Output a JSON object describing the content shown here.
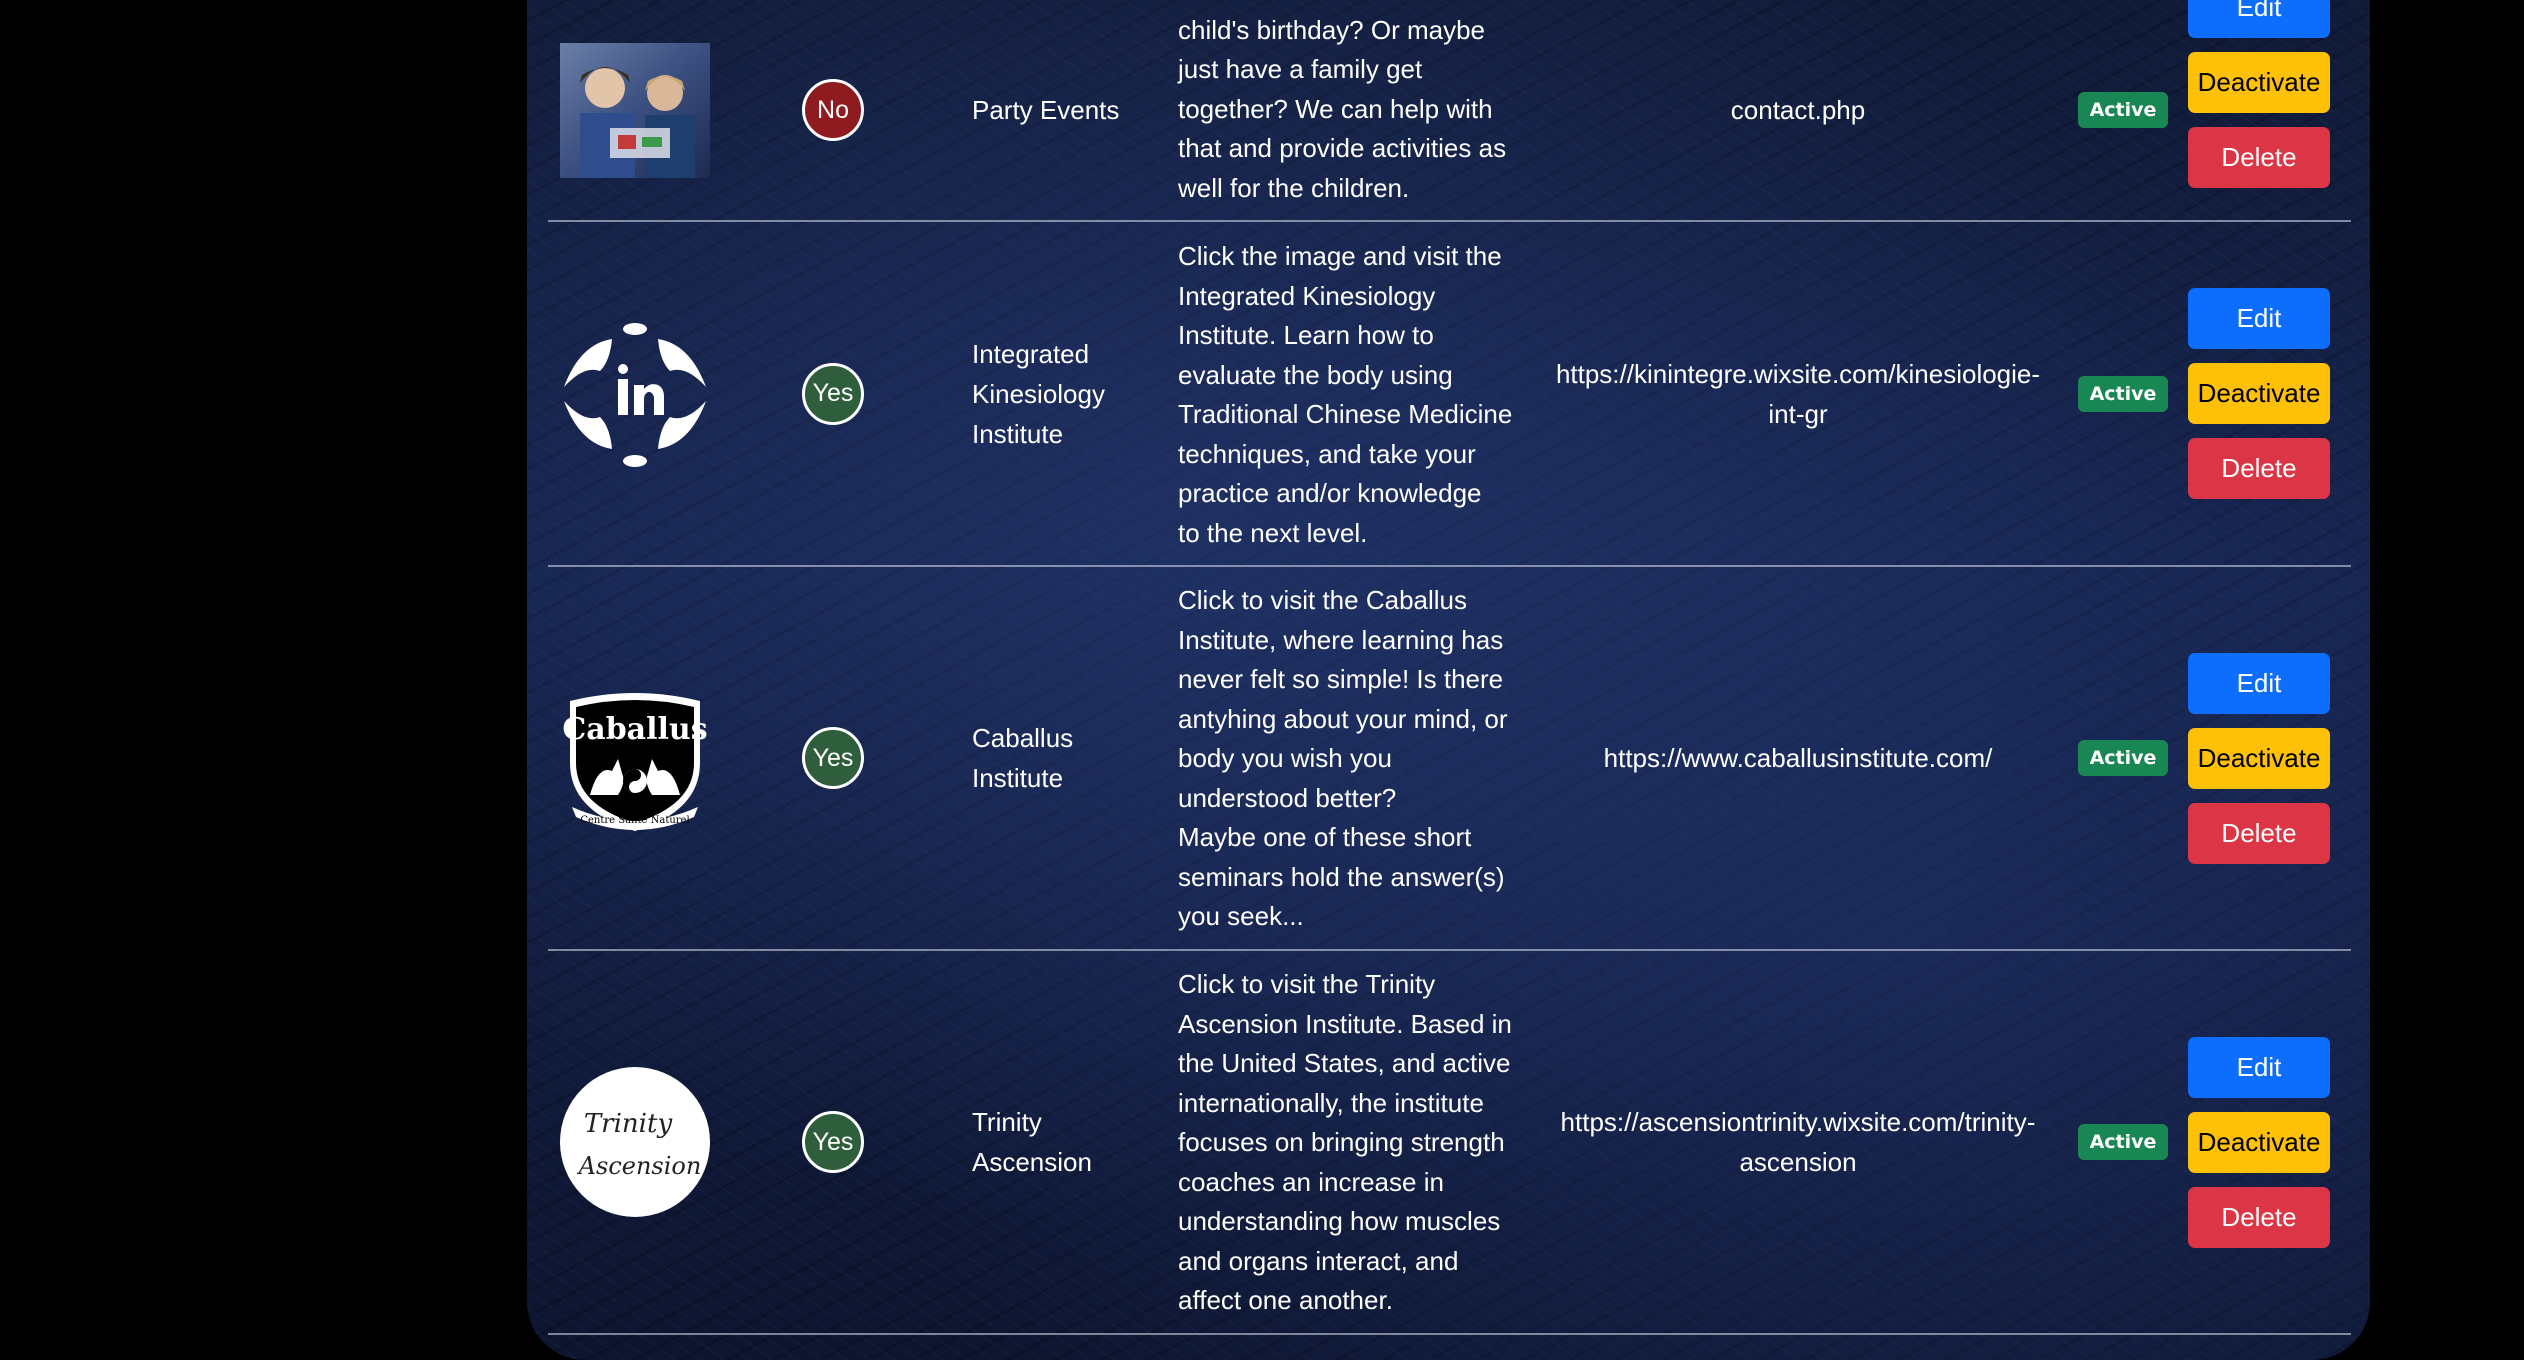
{
  "rows": [
    {
      "image_icon": "children-party-photo",
      "featured": "No",
      "title": "Party Events",
      "description": "child's birthday? Or maybe\njust have a family get\ntogether? We can help with\nthat and provide activities as\nwell for the children.",
      "link": "contact.php",
      "status": "Active",
      "actions": {
        "edit": "Edit",
        "deactivate": "Deactivate",
        "delete": "Delete"
      }
    },
    {
      "image_icon": "kinesiology-logo-icon",
      "featured": "Yes",
      "title": "Integrated\nKinesiology\nInstitute",
      "description": "Click the image and visit the\nIntegrated Kinesiology\nInstitute. Learn how to\nevaluate the body using\nTraditional Chinese Medicine\ntechniques, and take your\npractice and/or knowledge\nto the next level.",
      "link": "https://kinintegre.wixsite.com/kinesiologie-\nint-gr",
      "status": "Active",
      "actions": {
        "edit": "Edit",
        "deactivate": "Deactivate",
        "delete": "Delete"
      }
    },
    {
      "image_icon": "caballus-crest-logo",
      "image_text": {
        "name": "Caballus",
        "motto": "Centre Sante Naturel"
      },
      "featured": "Yes",
      "title": "Caballus\nInstitute",
      "description": "Click to visit the Caballus\nInstitute, where learning has\nnever felt so simple! Is there\nantyhing about your mind, or\nbody you wish you\nunderstood better?\nMaybe one of these short\nseminars hold the answer(s)\nyou seek...",
      "link": "https://www.caballusinstitute.com/",
      "status": "Active",
      "actions": {
        "edit": "Edit",
        "deactivate": "Deactivate",
        "delete": "Delete"
      }
    },
    {
      "image_icon": "trinity-ascension-logo",
      "image_text": {
        "line1": "Trinity",
        "line2": "Ascension"
      },
      "featured": "Yes",
      "title": "Trinity\nAscension",
      "description": "Click to visit the Trinity\nAscension Institute. Based in\nthe United States, and active\ninternationally, the institute\nfocuses on bringing strength\ncoaches an increase in\nunderstanding how muscles\nand organs interact, and\naffect one another.",
      "link": "https://ascensiontrinity.wixsite.com/trinity-\nascension",
      "status": "Active",
      "actions": {
        "edit": "Edit",
        "deactivate": "Deactivate",
        "delete": "Delete"
      }
    }
  ],
  "colors": {
    "edit": "#0d6efd",
    "deactivate": "#ffc107",
    "delete": "#dc3545",
    "active_badge": "#198754",
    "featured_no": "#8e1b20",
    "featured_yes": "#2e5e3c"
  }
}
